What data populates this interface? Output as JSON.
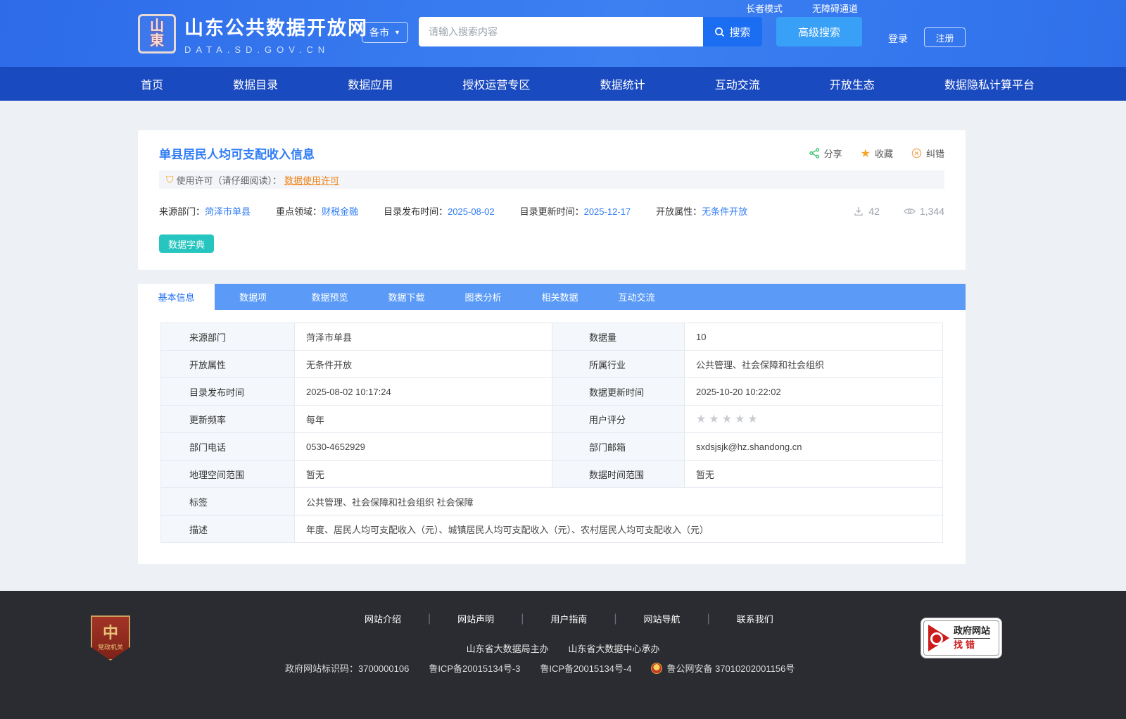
{
  "header": {
    "site_title": "山东公共数据开放网",
    "site_subtitle": "DATA.SD.GOV.CN",
    "seal_line1": "山",
    "seal_line2": "東",
    "city_selector": "各市",
    "search_placeholder": "请输入搜索内容",
    "search_button": "搜索",
    "advanced_search": "高级搜索",
    "elder_mode": "长者模式",
    "accessibility": "无障碍通道",
    "login": "登录",
    "register": "注册"
  },
  "nav": {
    "items": [
      "首页",
      "数据目录",
      "数据应用",
      "授权运营专区",
      "数据统计",
      "互动交流",
      "开放生态",
      "数据隐私计算平台"
    ]
  },
  "detail": {
    "title": "单县居民人均可支配收入信息",
    "share": "分享",
    "favorite": "收藏",
    "correct": "纠错",
    "license_label": "使用许可（请仔细阅读）：",
    "license_link": "数据使用许可",
    "meta": {
      "source_label": "来源部门：",
      "source_value": "菏泽市单县",
      "field_label": "重点领域：",
      "field_value": "财税金融",
      "publish_label": "目录发布时间：",
      "publish_value": "2025-08-02",
      "update_label": "目录更新时间：",
      "update_value": "2025-12-17",
      "open_label": "开放属性：",
      "open_value": "无条件开放",
      "downloads": "42",
      "views": "1,344"
    },
    "dictionary_button": "数据字典"
  },
  "tabs": [
    "基本信息",
    "数据项",
    "数据预览",
    "数据下载",
    "图表分析",
    "相关数据",
    "互动交流"
  ],
  "info_table": {
    "rows": [
      {
        "label1": "来源部门",
        "value1": "菏泽市单县",
        "label2": "数据量",
        "value2": "10"
      },
      {
        "label1": "开放属性",
        "value1": "无条件开放",
        "label2": "所属行业",
        "value2": "公共管理、社会保障和社会组织"
      },
      {
        "label1": "目录发布时间",
        "value1": "2025-08-02 10:17:24",
        "label2": "数据更新时间",
        "value2": "2025-10-20 10:22:02"
      },
      {
        "label1": "更新频率",
        "value1": "每年",
        "label2": "用户评分",
        "value2": "★★★★★"
      },
      {
        "label1": "部门电话",
        "value1": "0530-4652929",
        "label2": "部门邮箱",
        "value2": "sxdsjsjk@hz.shandong.cn"
      },
      {
        "label1": "地理空间范围",
        "value1": "暂无",
        "label2": "数据时间范围",
        "value2": "暂无"
      }
    ],
    "full_rows": [
      {
        "label": "标签",
        "value": "公共管理、社会保障和社会组织 社会保障"
      },
      {
        "label": "描述",
        "value": "年度、居民人均可支配收入（元）、城镇居民人均可支配收入（元）、农村居民人均可支配收入（元）"
      }
    ]
  },
  "footer": {
    "links": [
      "网站介绍",
      "网站声明",
      "用户指南",
      "网站导航",
      "联系我们"
    ],
    "host1": "山东省大数据局主办",
    "host2": "山东省大数据中心承办",
    "site_id": "政府网站标识码：3700000106",
    "icp1": "鲁ICP备20015134号-3",
    "icp2": "鲁ICP备20015134号-4",
    "police": "鲁公网安备 37010202001156号",
    "emblem_text": "党政机关",
    "find_error_top": "政府网站",
    "find_error_bottom": "找错"
  },
  "colors": {
    "accent": "#2f7cf6",
    "nav": "#1a4ac0",
    "tabbar": "#5b9bf7",
    "teal": "#27c5bf",
    "orange": "#f08519"
  }
}
